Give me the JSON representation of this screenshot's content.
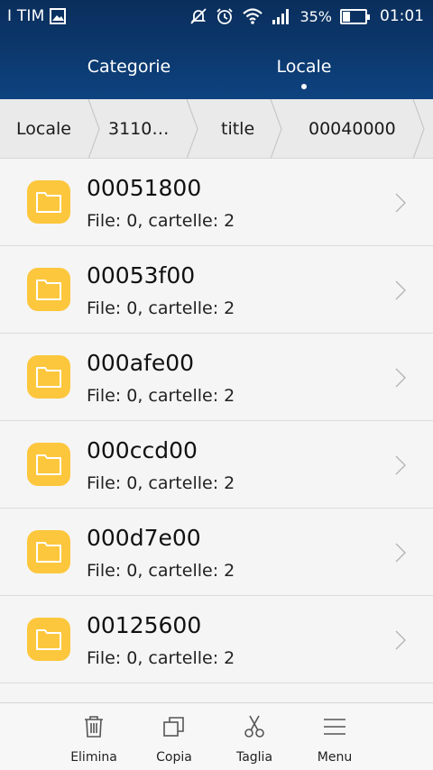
{
  "status_bar": {
    "carrier": "I TIM",
    "battery_percent": "35%",
    "time": "01:01",
    "icons": [
      "image-icon",
      "mute-icon",
      "alarm-icon",
      "wifi-icon",
      "signal-icon",
      "battery-icon"
    ]
  },
  "tabs": [
    {
      "label": "Categorie",
      "active": false
    },
    {
      "label": "Locale",
      "active": true
    }
  ],
  "breadcrumb": [
    "Locale",
    "3110…",
    "title",
    "00040000"
  ],
  "rows": [
    {
      "name": "00051800",
      "info": "File: 0, cartelle: 2"
    },
    {
      "name": "00053f00",
      "info": "File: 0, cartelle: 2"
    },
    {
      "name": "000afe00",
      "info": "File: 0, cartelle: 2"
    },
    {
      "name": "000ccd00",
      "info": "File: 0, cartelle: 2"
    },
    {
      "name": "000d7e00",
      "info": "File: 0, cartelle: 2"
    },
    {
      "name": "00125600",
      "info": "File: 0, cartelle: 2"
    }
  ],
  "bottom_bar": [
    {
      "label": "Elimina",
      "icon": "trash-icon"
    },
    {
      "label": "Copia",
      "icon": "copy-icon"
    },
    {
      "label": "Taglia",
      "icon": "scissors-icon"
    },
    {
      "label": "Menu",
      "icon": "menu-icon"
    }
  ],
  "colors": {
    "header": "#0c3a70",
    "folder": "#fdc73d",
    "background": "#f4f4f4"
  }
}
